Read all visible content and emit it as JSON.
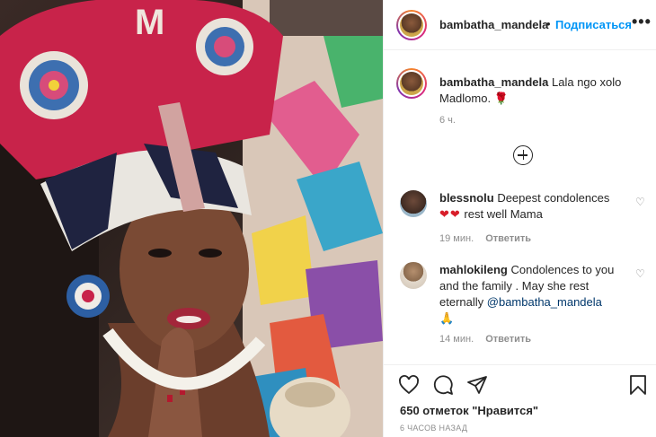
{
  "post": {
    "username": "bambatha_mandela",
    "separator": "•",
    "follow_label": "Подписаться",
    "more_icon": "more-options-icon",
    "more_glyph": "•••"
  },
  "caption": {
    "username": "bambatha_mandela",
    "text": "Lala ngo xolo Madlomo.",
    "emoji": "🌹",
    "time": "6 ч."
  },
  "load_more_icon": "plus-circle-icon",
  "comments": [
    {
      "username": "blessnolu",
      "text": "Deepest condolences",
      "hearts": "❤❤",
      "text_after": "rest well Mama",
      "time": "19 мин.",
      "reply_label": "Ответить",
      "like_glyph": "♡"
    },
    {
      "username": "mahlokileng",
      "text": "Condolences to you and the family . May she rest eternally",
      "mention": "@bambatha_mandela",
      "emoji": "🙏",
      "time": "14 мин.",
      "reply_label": "Ответить",
      "like_glyph": "♡"
    }
  ],
  "actions": {
    "icons": [
      "heart-icon",
      "comment-icon",
      "share-icon",
      "bookmark-icon"
    ],
    "likes": "650 отметок \"Нравится\"",
    "posted": "6 ЧАСОВ НАЗАД"
  },
  "photo": {
    "headdress_letter": "M"
  },
  "colors": {
    "accent": "#0095f6",
    "text": "#262626",
    "muted": "#8e8e8e",
    "headdress_red": "#c8234a"
  }
}
